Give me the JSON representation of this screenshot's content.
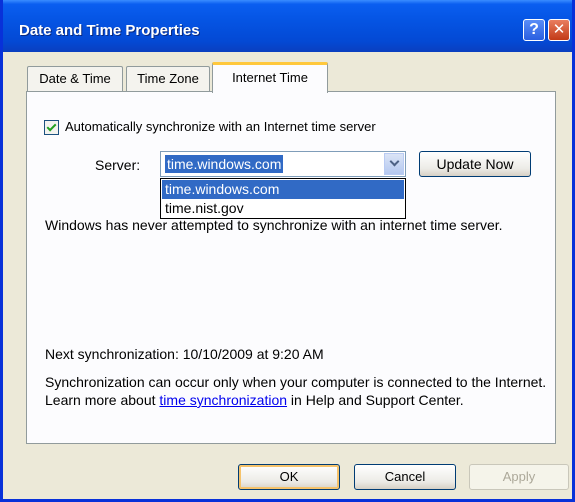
{
  "window": {
    "title": "Date and Time Properties",
    "help_glyph": "?",
    "close_glyph": "✕"
  },
  "tabs": [
    {
      "label": "Date & Time",
      "active": false
    },
    {
      "label": "Time Zone",
      "active": false
    },
    {
      "label": "Internet Time",
      "active": true
    }
  ],
  "internet_time": {
    "auto_sync_label": "Automatically synchronize with an Internet time server",
    "auto_sync_checked": true,
    "server_label": "Server:",
    "server_value": "time.windows.com",
    "server_options": [
      "time.windows.com",
      "time.nist.gov"
    ],
    "update_button": "Update Now",
    "status_text": "Windows has never attempted to synchronize with an internet time server.",
    "next_sync": "Next synchronization: 10/10/2009 at 9:20 AM",
    "info_pre": "Synchronization can occur only when your computer is connected to the Internet.  Learn more about ",
    "info_link": "time synchronization",
    "info_post": " in Help and Support Center."
  },
  "buttons": {
    "ok": "OK",
    "cancel": "Cancel",
    "apply": "Apply"
  },
  "colors": {
    "titlebar": "#0554e3",
    "selection": "#316ac5",
    "dialog_bg": "#ece9d8",
    "active_tab_accent": "#ffc83c"
  }
}
